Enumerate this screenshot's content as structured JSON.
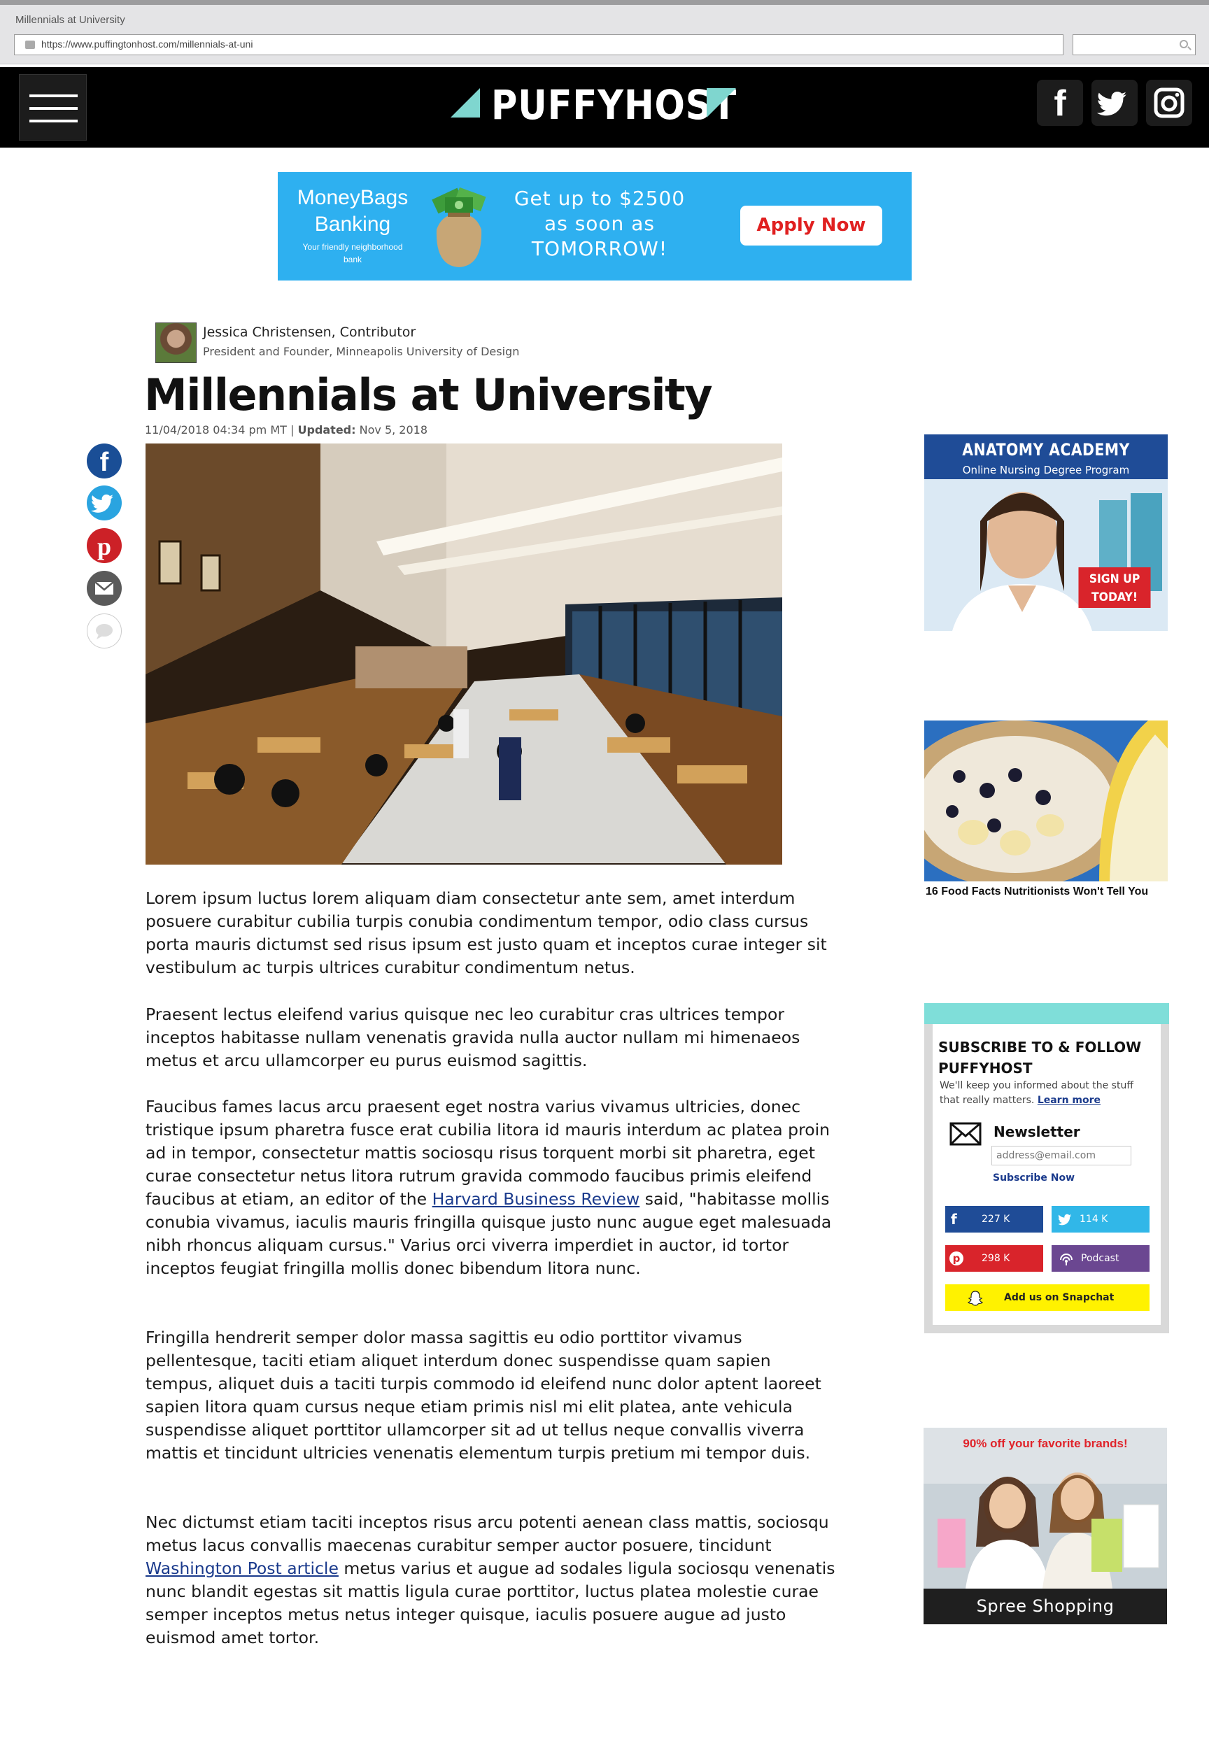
{
  "browser": {
    "window_title": "Millennials at University",
    "url": "https://www.puffingtonhost.com/millennials-at-uni",
    "search_value": ""
  },
  "site": {
    "logo_text": "PUFFYHOST",
    "accent_color": "#7fd6cf",
    "social_icons": [
      "facebook-icon",
      "twitter-icon",
      "instagram-icon"
    ]
  },
  "top_ad": {
    "brand": "MoneyBags Banking",
    "tagline": "Your friendly neighborhood bank",
    "offer": "Get up to $2500 as soon as TOMORROW!",
    "cta": "Apply Now",
    "bg_color": "#2eb0f0"
  },
  "article": {
    "author": "Jessica Christensen, Contributor",
    "author_role": "President and Founder, Minneapolis University of Design",
    "title": "Millennials at University",
    "published": "11/04/2018 04:34 pm MT",
    "updated_label": "Updated",
    "updated_date": "Nov 5, 2018",
    "paragraphs": [
      "Lorem ipsum luctus lorem aliquam diam consectetur ante sem, amet interdum posuere curabitur cubilia turpis conubia condimentum tempor, odio class cursus porta mauris dictumst sed risus ipsum est justo quam et inceptos curae integer sit vestibulum ac turpis ultrices curabitur condimentum netus.",
      "Praesent lectus eleifend varius quisque nec leo curabitur cras ultrices tempor inceptos habitasse nullam venenatis gravida nulla auctor nullam mi himenaeos metus et arcu ullamcorper eu purus euismod sagittis."
    ],
    "p3_before": "Faucibus fames lacus arcu praesent eget nostra varius vivamus ultricies, donec tristique ipsum pharetra fusce erat cubilia litora id mauris interdum ac platea proin ad in tempor, consectetur mattis sociosqu risus torquent morbi sit pharetra, eget curae consectetur netus litora rutrum gravida commodo faucibus primis eleifend faucibus at etiam, an editor of the",
    "p3_link": "Harvard Business Review",
    "p3_after": "said, \"habitasse mollis conubia vivamus, iaculis mauris fringilla quisque justo nunc augue eget malesuada nibh rhoncus aliquam cursus.\" Varius orci viverra imperdiet in auctor, id tortor inceptos feugiat fringilla mollis donec bibendum litora nunc.",
    "p4": "Fringilla hendrerit semper dolor massa sagittis eu odio porttitor vivamus pellentesque, taciti etiam aliquet interdum donec suspendisse quam sapien tempus, aliquet duis a taciti turpis commodo id eleifend nunc dolor aptent laoreet sapien litora quam cursus neque etiam primis nisl mi elit platea, ante vehicula suspendisse aliquet porttitor ullamcorper sit ad ut tellus neque convallis viverra mattis et tincidunt ultricies venenatis elementum turpis pretium mi tempor duis.",
    "p5_before": "Nec dictumst etiam taciti inceptos risus arcu potenti aenean class mattis, sociosqu metus lacus convallis maecenas curabitur semper auctor posuere, tincidunt",
    "p5_link": "Washington Post article",
    "p5_after": "metus varius et augue ad sodales ligula sociosqu venenatis nunc blandit egestas sit mattis ligula curae porttitor, luctus platea molestie curae semper inceptos metus netus integer quisque, iaculis posuere augue ad justo euismod amet tortor."
  },
  "share_rail": [
    "facebook-icon",
    "twitter-icon",
    "pinterest-icon",
    "mail-icon",
    "comment-icon"
  ],
  "sidebar": {
    "anatomy_ad": {
      "title": "ANATOMY ACADEMY",
      "subtitle": "Online Nursing Degree Program",
      "cta": "SIGN UP TODAY!"
    },
    "food_ad": {
      "caption": "16 Food Facts Nutritionists Won't Tell You"
    },
    "newsletter": {
      "title": "SUBSCRIBE TO & FOLLOW PUFFYHOST",
      "description": "We'll keep you informed about the stuff that really matters.",
      "learn_more": "Learn more",
      "label": "Newsletter",
      "placeholder": "address@email.com",
      "submit": "Subscribe Now",
      "facebook_count": "227 K",
      "twitter_count": "114 K",
      "pinterest_count": "298 K",
      "podcast_label": "Podcast",
      "snapchat_label": "Add us on Snapchat"
    },
    "spree_ad": {
      "promo": "90% off your favorite brands!",
      "brand": "Spree Shopping"
    }
  }
}
